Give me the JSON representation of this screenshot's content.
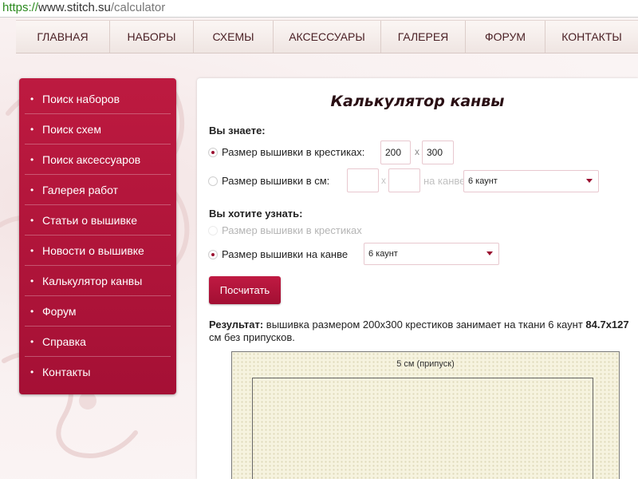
{
  "browser": {
    "url_protocol": "https://",
    "url_domain": "www.stitch.su",
    "url_path": "/calculator"
  },
  "topnav": {
    "items": [
      {
        "label": "ГЛАВНАЯ"
      },
      {
        "label": "НАБОРЫ"
      },
      {
        "label": "СХЕМЫ"
      },
      {
        "label": "АКСЕССУАРЫ"
      },
      {
        "label": "ГАЛЕРЕЯ"
      },
      {
        "label": "ФОРУМ"
      },
      {
        "label": "КОНТАКТЫ"
      }
    ]
  },
  "sidebar": {
    "bullet": "•",
    "items": [
      {
        "label": "Поиск наборов"
      },
      {
        "label": "Поиск схем"
      },
      {
        "label": "Поиск аксессуаров"
      },
      {
        "label": "Галерея работ"
      },
      {
        "label": "Статьи о вышивке"
      },
      {
        "label": "Новости о вышивке"
      },
      {
        "label": "Калькулятор канвы"
      },
      {
        "label": "Форум"
      },
      {
        "label": "Справка"
      },
      {
        "label": "Контакты"
      }
    ]
  },
  "calculator": {
    "title": "Калькулятор канвы",
    "known_title": "Вы знаете:",
    "known_stitches_label": "Размер вышивки в крестиках:",
    "stitches_width": "200",
    "stitches_height": "300",
    "x_separator": "x",
    "known_cm_label": "Размер вышивки в см:",
    "cm_width": "",
    "cm_height": "",
    "on_canvas_label": "на канве",
    "known_canvas_select": "6 каунт",
    "want_title": "Вы хотите узнать:",
    "want_stitches_label": "Размер вышивки в крестиках",
    "want_canvas_label": "Размер вышивки на канве",
    "want_canvas_select": "6 каунт",
    "calculate_button": "Посчитать",
    "result_prefix": "Результат:",
    "result_text": " вышивка размером 200x300 крестиков занимает на ткани 6 каунт ",
    "result_value": "84.7x127",
    "result_suffix": " см без припусков.",
    "canvas_allowance_label": "5 см (припуск)"
  },
  "colors": {
    "brand_red": "#b0143a",
    "link_green": "#2b8a1e"
  }
}
